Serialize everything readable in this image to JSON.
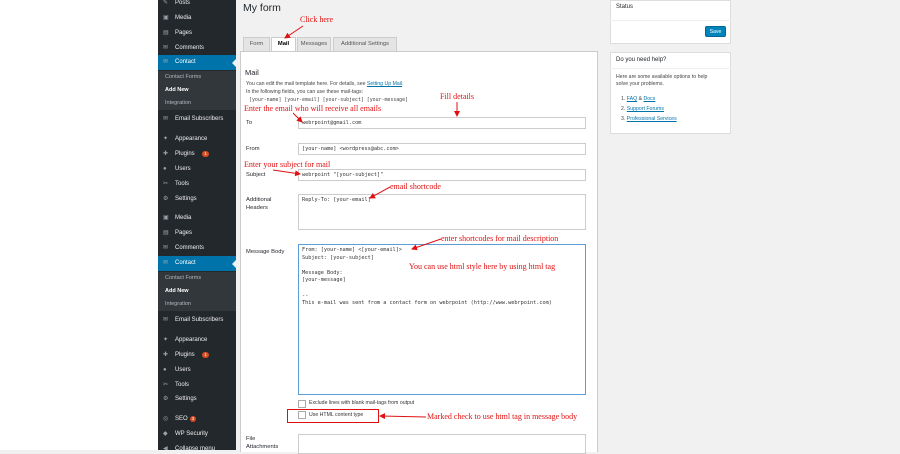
{
  "sidebar": {
    "top_items": [
      {
        "label": "Posts",
        "icon": "pin-icon"
      },
      {
        "label": "Media",
        "icon": "media-icon"
      },
      {
        "label": "Pages",
        "icon": "pages-icon"
      },
      {
        "label": "Comments",
        "icon": "comments-icon"
      }
    ],
    "contact1": {
      "label": "Contact",
      "subs": [
        "Contact Forms",
        "Add New",
        "Integration"
      ]
    },
    "mid_items1": [
      {
        "label": "Email Subscribers",
        "icon": "email-icon"
      },
      {
        "label": "Appearance",
        "icon": "appearance-icon"
      },
      {
        "label": "Plugins",
        "icon": "plugins-icon",
        "badge": "1"
      },
      {
        "label": "Users",
        "icon": "users-icon"
      },
      {
        "label": "Tools",
        "icon": "tools-icon"
      },
      {
        "label": "Settings",
        "icon": "settings-icon"
      },
      {
        "label": "Media",
        "icon": "media-icon"
      },
      {
        "label": "Pages",
        "icon": "pages-icon"
      },
      {
        "label": "Comments",
        "icon": "comments-icon"
      }
    ],
    "contact2": {
      "label": "Contact",
      "subs": [
        "Contact Forms",
        "Add New",
        "Integration"
      ]
    },
    "bottom_items": [
      {
        "label": "Email Subscribers",
        "icon": "email-icon"
      },
      {
        "label": "Appearance",
        "icon": "appearance-icon"
      },
      {
        "label": "Plugins",
        "icon": "plugins-icon",
        "badge": "1"
      },
      {
        "label": "Users",
        "icon": "users-icon"
      },
      {
        "label": "Tools",
        "icon": "tools-icon"
      },
      {
        "label": "Settings",
        "icon": "settings-icon"
      },
      {
        "label": "SEO",
        "icon": "seo-icon",
        "badge": "3"
      },
      {
        "label": "WP Security",
        "icon": "shield-icon"
      },
      {
        "label": "Collapse menu",
        "icon": "collapse-icon"
      }
    ]
  },
  "page": {
    "title": "My form"
  },
  "tabs": [
    "Form",
    "Mail",
    "Messages",
    "Additional Settings"
  ],
  "mail": {
    "heading": "Mail",
    "intro1a": "You can edit the mail template here. For details, see ",
    "intro1_link": "Setting Up Mail",
    "intro1b": ".",
    "intro2": "In the following fields, you can use these mail-tags:",
    "tags": "[your-name] [your-email] [your-subject] [your-message]",
    "to_label": "To",
    "to_value": "webrpoint@gmail.com",
    "from_label": "From",
    "from_value": "[your-name] <wordpress@abc.com>",
    "subject_label": "Subject",
    "subject_value": "webrpoint \"[your-subject]\"",
    "headers_label_1": "Additional",
    "headers_label_2": "Headers",
    "headers_value": "Reply-To: [your-email]",
    "body_label": "Message Body",
    "body_value": "From: [your-name] <[your-email]>\nSubject: [your-subject]\n\nMessage Body:\n[your-message]\n\n--\nThis e-mail was sent from a contact form on webrpoint (http://www.webrpoint.com)",
    "exclude_label": "Exclude lines with blank mail-tags from output",
    "html_label": "Use HTML content type",
    "attach_label_1": "File",
    "attach_label_2": "Attachments"
  },
  "status_box": {
    "title": "Status",
    "save_label": "Save"
  },
  "help_box": {
    "title": "Do you need help?",
    "text1": "Here are some available options to help",
    "text2": "solve your problems.",
    "l1a": "1. ",
    "l1_faq": "FAQ",
    "l1_amp": " & ",
    "l1_docs": "Docs",
    "l2a": "2. ",
    "l2_link": "Support Forums",
    "l3a": "3. ",
    "l3_link": "Professional Services"
  },
  "annotations": {
    "click_here": "Click here",
    "fill_details": "Fill details",
    "email_receive": "Enter the email who will receive all emails",
    "subject": "Enter your subject for mail",
    "shortcode": "email shortcode",
    "shortcodes_desc": "enter shortcodes for mail description",
    "html_style": "You can use html style here by using html tag",
    "marked": "Marked check to use html tag in message body"
  },
  "colors": {
    "accent": "#0073aa",
    "annotation": "#e01010",
    "sidebar": "#23282d",
    "button": "#0085ba"
  }
}
